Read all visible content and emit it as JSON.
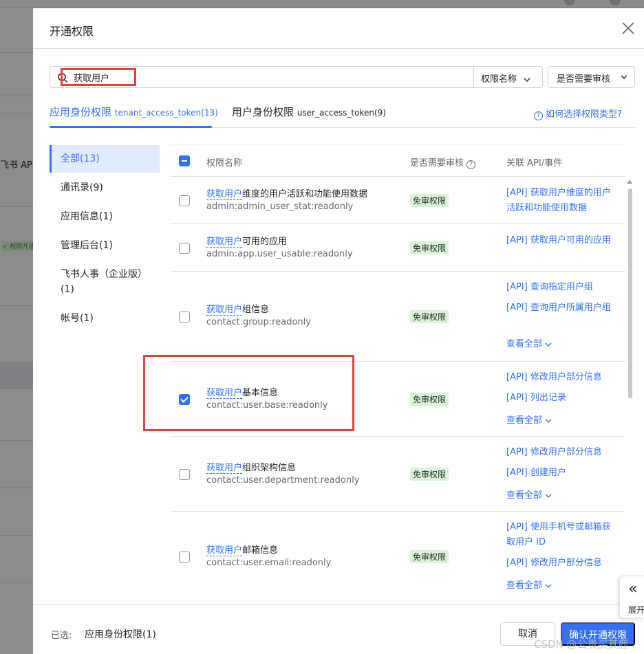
{
  "background": {
    "api_text": "飞书 API",
    "badge_text": "✓ 权限开通"
  },
  "modal": {
    "title": "开通权限",
    "search": {
      "value": "获取用户",
      "field_label": "权限名称",
      "filter_label": "是否需要审核"
    },
    "tabs": [
      {
        "label": "应用身份权限",
        "token": "tenant_access_token(13)"
      },
      {
        "label": "用户身份权限",
        "token": "user_access_token(9)"
      }
    ],
    "help_link": "如何选择权限类型?",
    "categories": [
      {
        "label": "全部(13)"
      },
      {
        "label": "通讯录(9)"
      },
      {
        "label": "应用信息(1)"
      },
      {
        "label": "管理后台(1)"
      },
      {
        "label": "飞书人事（企业版）(1)"
      },
      {
        "label": "帐号(1)"
      }
    ],
    "table": {
      "headers": {
        "name": "权限名称",
        "review": "是否需要审核",
        "review_help": "?",
        "api": "关联 API/事件"
      },
      "rows": [
        {
          "name_highlight": "获取用户",
          "name_rest": "维度的用户活跃和功能使用数据",
          "code": "admin:admin_user_stat:readonly",
          "badge": "免审权限",
          "checked": false,
          "apis": [
            "[API] 获取用户维度的用户活跃和功能使用数据"
          ],
          "more": ""
        },
        {
          "name_highlight": "获取用户",
          "name_rest": "可用的应用",
          "code": "admin:app.user_usable:readonly",
          "badge": "免审权限",
          "checked": false,
          "apis": [
            "[API] 获取用户可用的应用"
          ],
          "more": ""
        },
        {
          "name_highlight": "获取用户",
          "name_rest": "组信息",
          "code": "contact:group:readonly",
          "badge": "免审权限",
          "checked": false,
          "apis": [
            "[API] 查询指定用户组",
            "[API] 查询用户所属用户组"
          ],
          "more": "查看全部"
        },
        {
          "name_highlight": "获取用户",
          "name_rest": "基本信息",
          "code": "contact:user.base:readonly",
          "badge": "免审权限",
          "checked": true,
          "apis": [
            "[API] 修改用户部分信息",
            "[API] 列出记录"
          ],
          "more": "查看全部"
        },
        {
          "name_highlight": "获取用户",
          "name_rest": "组织架构信息",
          "code": "contact:user.department:readonly",
          "badge": "免审权限",
          "checked": false,
          "apis": [
            "[API] 修改用户部分信息",
            "[API] 创建用户"
          ],
          "more": "查看全部"
        },
        {
          "name_highlight": "获取用户",
          "name_rest": "邮箱信息",
          "code": "contact:user.email:readonly",
          "badge": "免审权限",
          "checked": false,
          "apis": [
            "[API] 使用手机号或邮箱获取用户 ID",
            "[API] 修改用户部分信息"
          ],
          "more": "查看全部"
        }
      ]
    },
    "footer": {
      "selected_label": "已选:",
      "selected_value": "应用身份权限(1)",
      "cancel": "取消",
      "confirm": "确认开通权限"
    }
  },
  "expand_panel": {
    "icon": "«",
    "label": "展开"
  },
  "watermark": "CSDN @公贵买其鹿",
  "colors": {
    "accent": "#3370ff",
    "badge_bg": "#d9f5d6",
    "annotation_red": "#e8413d"
  }
}
